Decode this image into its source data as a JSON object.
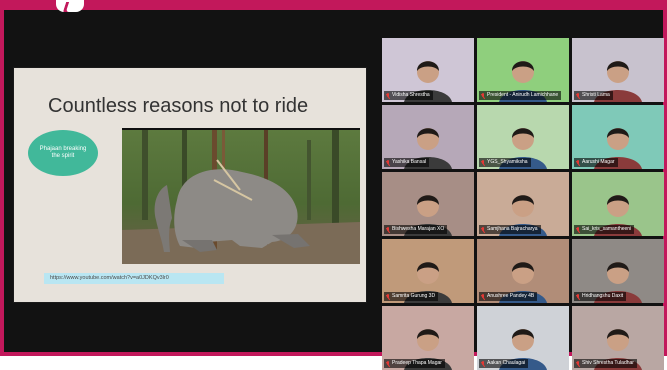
{
  "slide": {
    "title": "Countless reasons not to ride",
    "oval_text": "Phajaan breaking the spirit",
    "url": "https://www.youtube.com/watch?v=a0JDKQv3lr0"
  },
  "participants": [
    {
      "name": "Vidisha Shrestha",
      "muted": true,
      "active": true,
      "bg": "#cfc6d6"
    },
    {
      "name": "President - Anirudh Lamichhane",
      "muted": true,
      "active": false,
      "bg": "#8fcf7d"
    },
    {
      "name": "Shristi Lama",
      "muted": true,
      "active": false,
      "bg": "#c8c2ce"
    },
    {
      "name": "Yashika Bansal",
      "muted": true,
      "active": false,
      "bg": "#b6a8b8"
    },
    {
      "name": "YGS_Shyamiksha",
      "muted": true,
      "active": false,
      "bg": "#b8d8ae"
    },
    {
      "name": "Aarushi Magar",
      "muted": true,
      "active": false,
      "bg": "#7fc9b8"
    },
    {
      "name": "Bishwesha Marajan XO",
      "muted": true,
      "active": false,
      "bg": "#a78e86"
    },
    {
      "name": "Samjhana Bajracharya",
      "muted": true,
      "active": false,
      "bg": "#c9ab97"
    },
    {
      "name": "Sai_kris_samantheeni",
      "muted": true,
      "active": false,
      "bg": "#9ac58b"
    },
    {
      "name": "Samrita Gurung 3D",
      "muted": true,
      "active": false,
      "bg": "#c09a7a"
    },
    {
      "name": "Anushree Pandey 4B",
      "muted": true,
      "active": false,
      "bg": "#b18d78"
    },
    {
      "name": "Hridhangshu Daxit",
      "muted": true,
      "active": false,
      "bg": "#8f8a86"
    },
    {
      "name": "Pradeep Thapa Magar",
      "muted": true,
      "active": false,
      "bg": "#c8a8a2"
    },
    {
      "name": "Aakan Chaulagai",
      "muted": true,
      "active": false,
      "bg": "#cfd2d7"
    },
    {
      "name": "Shiv Shrestha Tuladhar",
      "muted": true,
      "active": false,
      "bg": "#b9a7a3"
    }
  ],
  "colors": {
    "frame": "#c2185b",
    "oval": "#41b89a",
    "url_bg": "#b9e6f2",
    "active_border": "#e8d44d"
  }
}
